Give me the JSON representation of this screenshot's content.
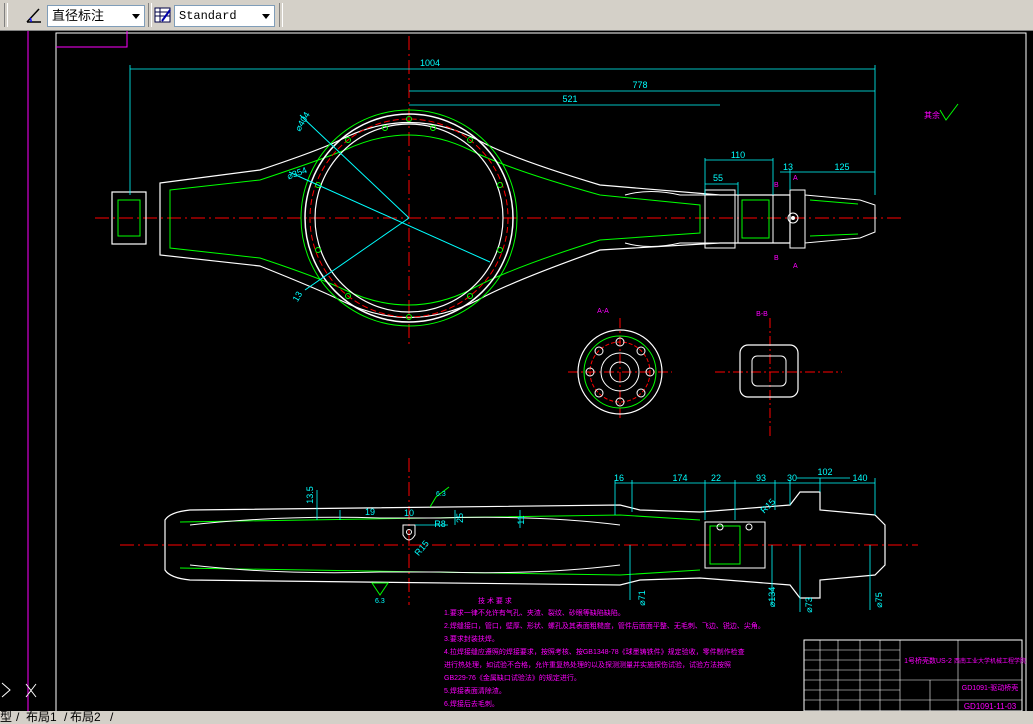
{
  "toolbar": {
    "dim_style_label": "直径标注",
    "text_style_label": "Standard"
  },
  "layout_tabs": [
    "型",
    "布局1",
    "布局2"
  ],
  "dimensions": {
    "top_view": [
      "1004",
      "778",
      "521",
      "110",
      "55",
      "13",
      "125",
      "⌀404",
      "⌀354",
      "13"
    ],
    "bottom_view": [
      "16",
      "174",
      "22",
      "93",
      "30",
      "102",
      "140",
      "13.5",
      "19",
      "R8",
      "10",
      "25",
      "11",
      "R15",
      "R15",
      "⌀71",
      "⌀134",
      "⌀73",
      "⌀75"
    ],
    "roughness_top": "6.3",
    "roughness_bottom_left": "6.3",
    "roughness_bottom_mid": "6.3",
    "roughness_rest": "其余"
  },
  "section_labels": {
    "aa": "A-A",
    "bb": "B-B",
    "a_marker": "A",
    "b_marker": "B"
  },
  "tech_notes": {
    "title": "技 术 要 求",
    "lines": [
      "1.要求一律不允许有气孔、夹渣、裂纹、砂眼等缺陷缺陷。",
      "2.焊缝接口，管口，壁厚、形状、螺孔及其表面粗糙度，管件后面面平整、无毛刺、飞边、锐边、尖角。",
      "3.要求封装扶焊。",
      "4.拉焊接缝应遵照的焊接要求，按照考核、按GB1348-78《球墨铸铁件》规定验收，零件制作检查",
      "进行热处理，如试验不合格，允许重复热处理的以及探测测量并实施探伤试验，试验方法按照",
      "GB229-76《金属缺口试验法》的规定进行。",
      "5.焊接表面清除渣。",
      "6.焊接后去毛刺。"
    ]
  },
  "title_block": {
    "part_name": "1号桥壳数US-2",
    "school": "西南工业大学机械工程学院",
    "drawing_no": "GD1091-驱动桥壳",
    "drawing_no_2": "GD1091-11-03"
  },
  "colors": {
    "background": "#000000",
    "geometry": "#ffffff",
    "outline_green": "#00ff00",
    "dimension_cyan": "#00ffff",
    "centerline_red": "#ff0000",
    "annotation_magenta": "#ff00ff"
  }
}
